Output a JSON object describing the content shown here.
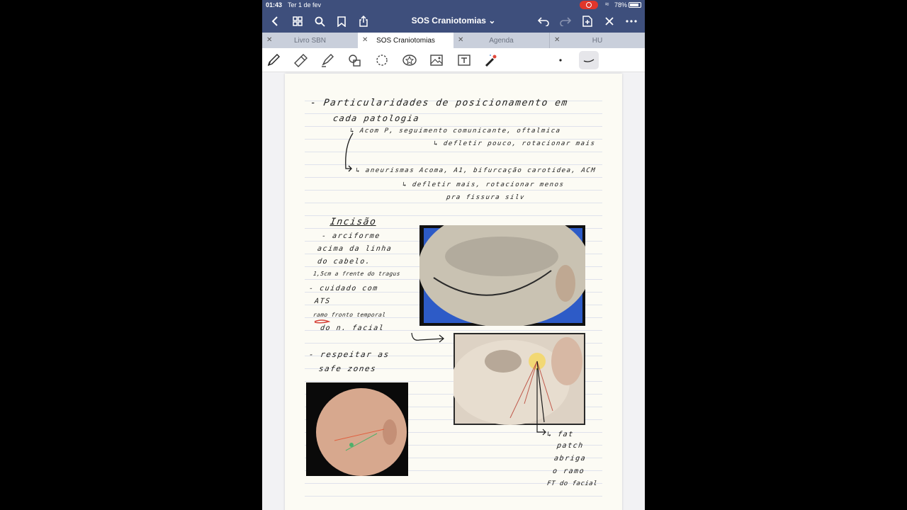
{
  "status": {
    "time": "01:43",
    "date": "Ter 1 de fev",
    "battery": "78%"
  },
  "nav": {
    "title": "SOS Craniotomias"
  },
  "tabs": [
    {
      "label": "Livro SBN",
      "active": false
    },
    {
      "label": "SOS Craniotomias",
      "active": true
    },
    {
      "label": "Agenda",
      "active": false
    },
    {
      "label": "HU",
      "active": false
    }
  ],
  "notes": {
    "line1": "- Particularidades de posicionamento em",
    "line2": "cada patologia",
    "line3": "↳ Acom P, seguimento comunicante, oftalmica",
    "line4": "↳ defletir pouco, rotacionar mais",
    "line5": "↳ aneurismas Acoma, A1, bifurcação carotidea, ACM",
    "line6": "↳ defletir mais, rotacionar menos",
    "line7": "pra fissura silv",
    "incision_title": "Incisão",
    "inc1": "- arciforme",
    "inc2": "acima da linha",
    "inc3": "do cabelo.",
    "inc4": "1,5cm a frente do tragus",
    "inc5": "- cuidado com",
    "inc6": "ATS",
    "inc7": "ramo fronto temporal",
    "inc8": "do n. facial",
    "safe1": "- respeitar as",
    "safe2": "safe zones",
    "fat1": "↳ fat",
    "fat2": "patch",
    "fat3": "abriga",
    "fat4": "o ramo",
    "fat5": "FT do facial"
  }
}
